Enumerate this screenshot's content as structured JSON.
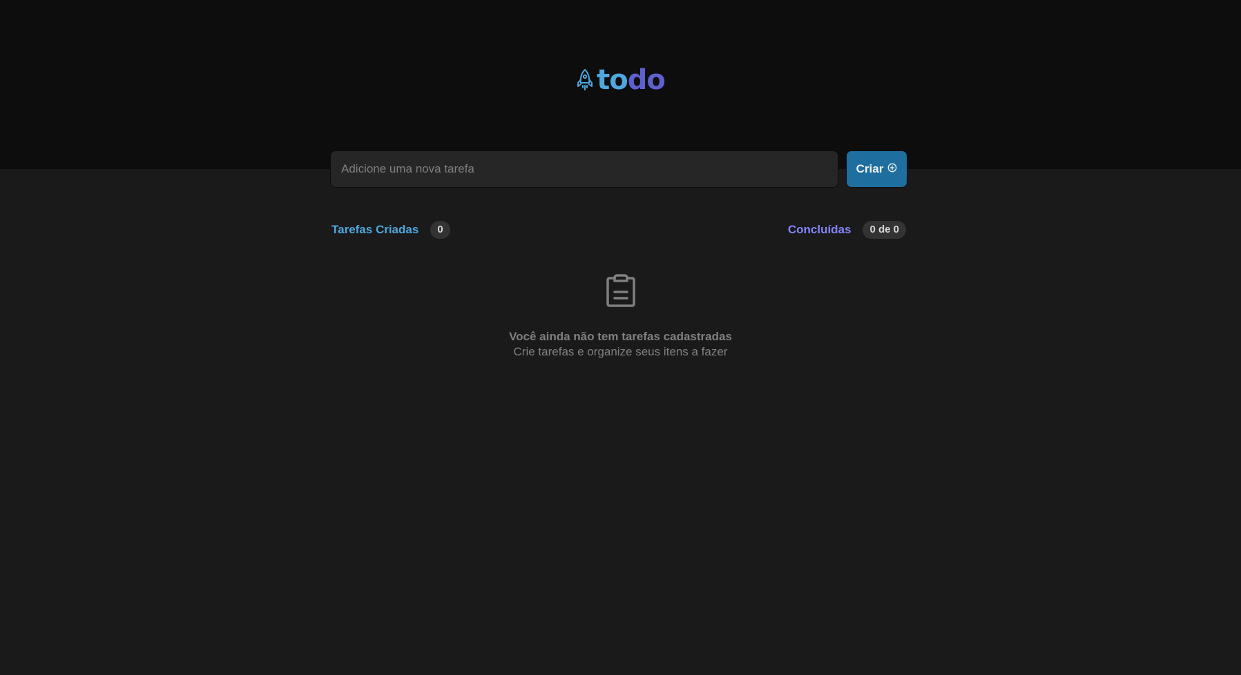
{
  "app": {
    "logo_part1": "to",
    "logo_part2": "do",
    "logo_icon": "rocket-icon"
  },
  "create": {
    "placeholder": "Adicione uma nova tarefa",
    "value": "",
    "button_label": "Criar",
    "button_icon": "plus-circle-icon"
  },
  "counters": {
    "created_label": "Tarefas Criadas",
    "created_count": "0",
    "done_label": "Concluídas",
    "done_count": "0 de 0"
  },
  "empty_state": {
    "icon": "clipboard-icon",
    "title": "Você ainda não tem tarefas cadastradas",
    "subtitle": "Crie tarefas e organize seus itens a fazer"
  },
  "colors": {
    "header_bg": "#0d0d0d",
    "page_bg": "#1a1a1a",
    "blue": "#4ea8de",
    "purple": "#5e60ce",
    "purple_light": "#8284fa",
    "button_bg": "#1e6f9f",
    "muted_text": "#808080"
  }
}
